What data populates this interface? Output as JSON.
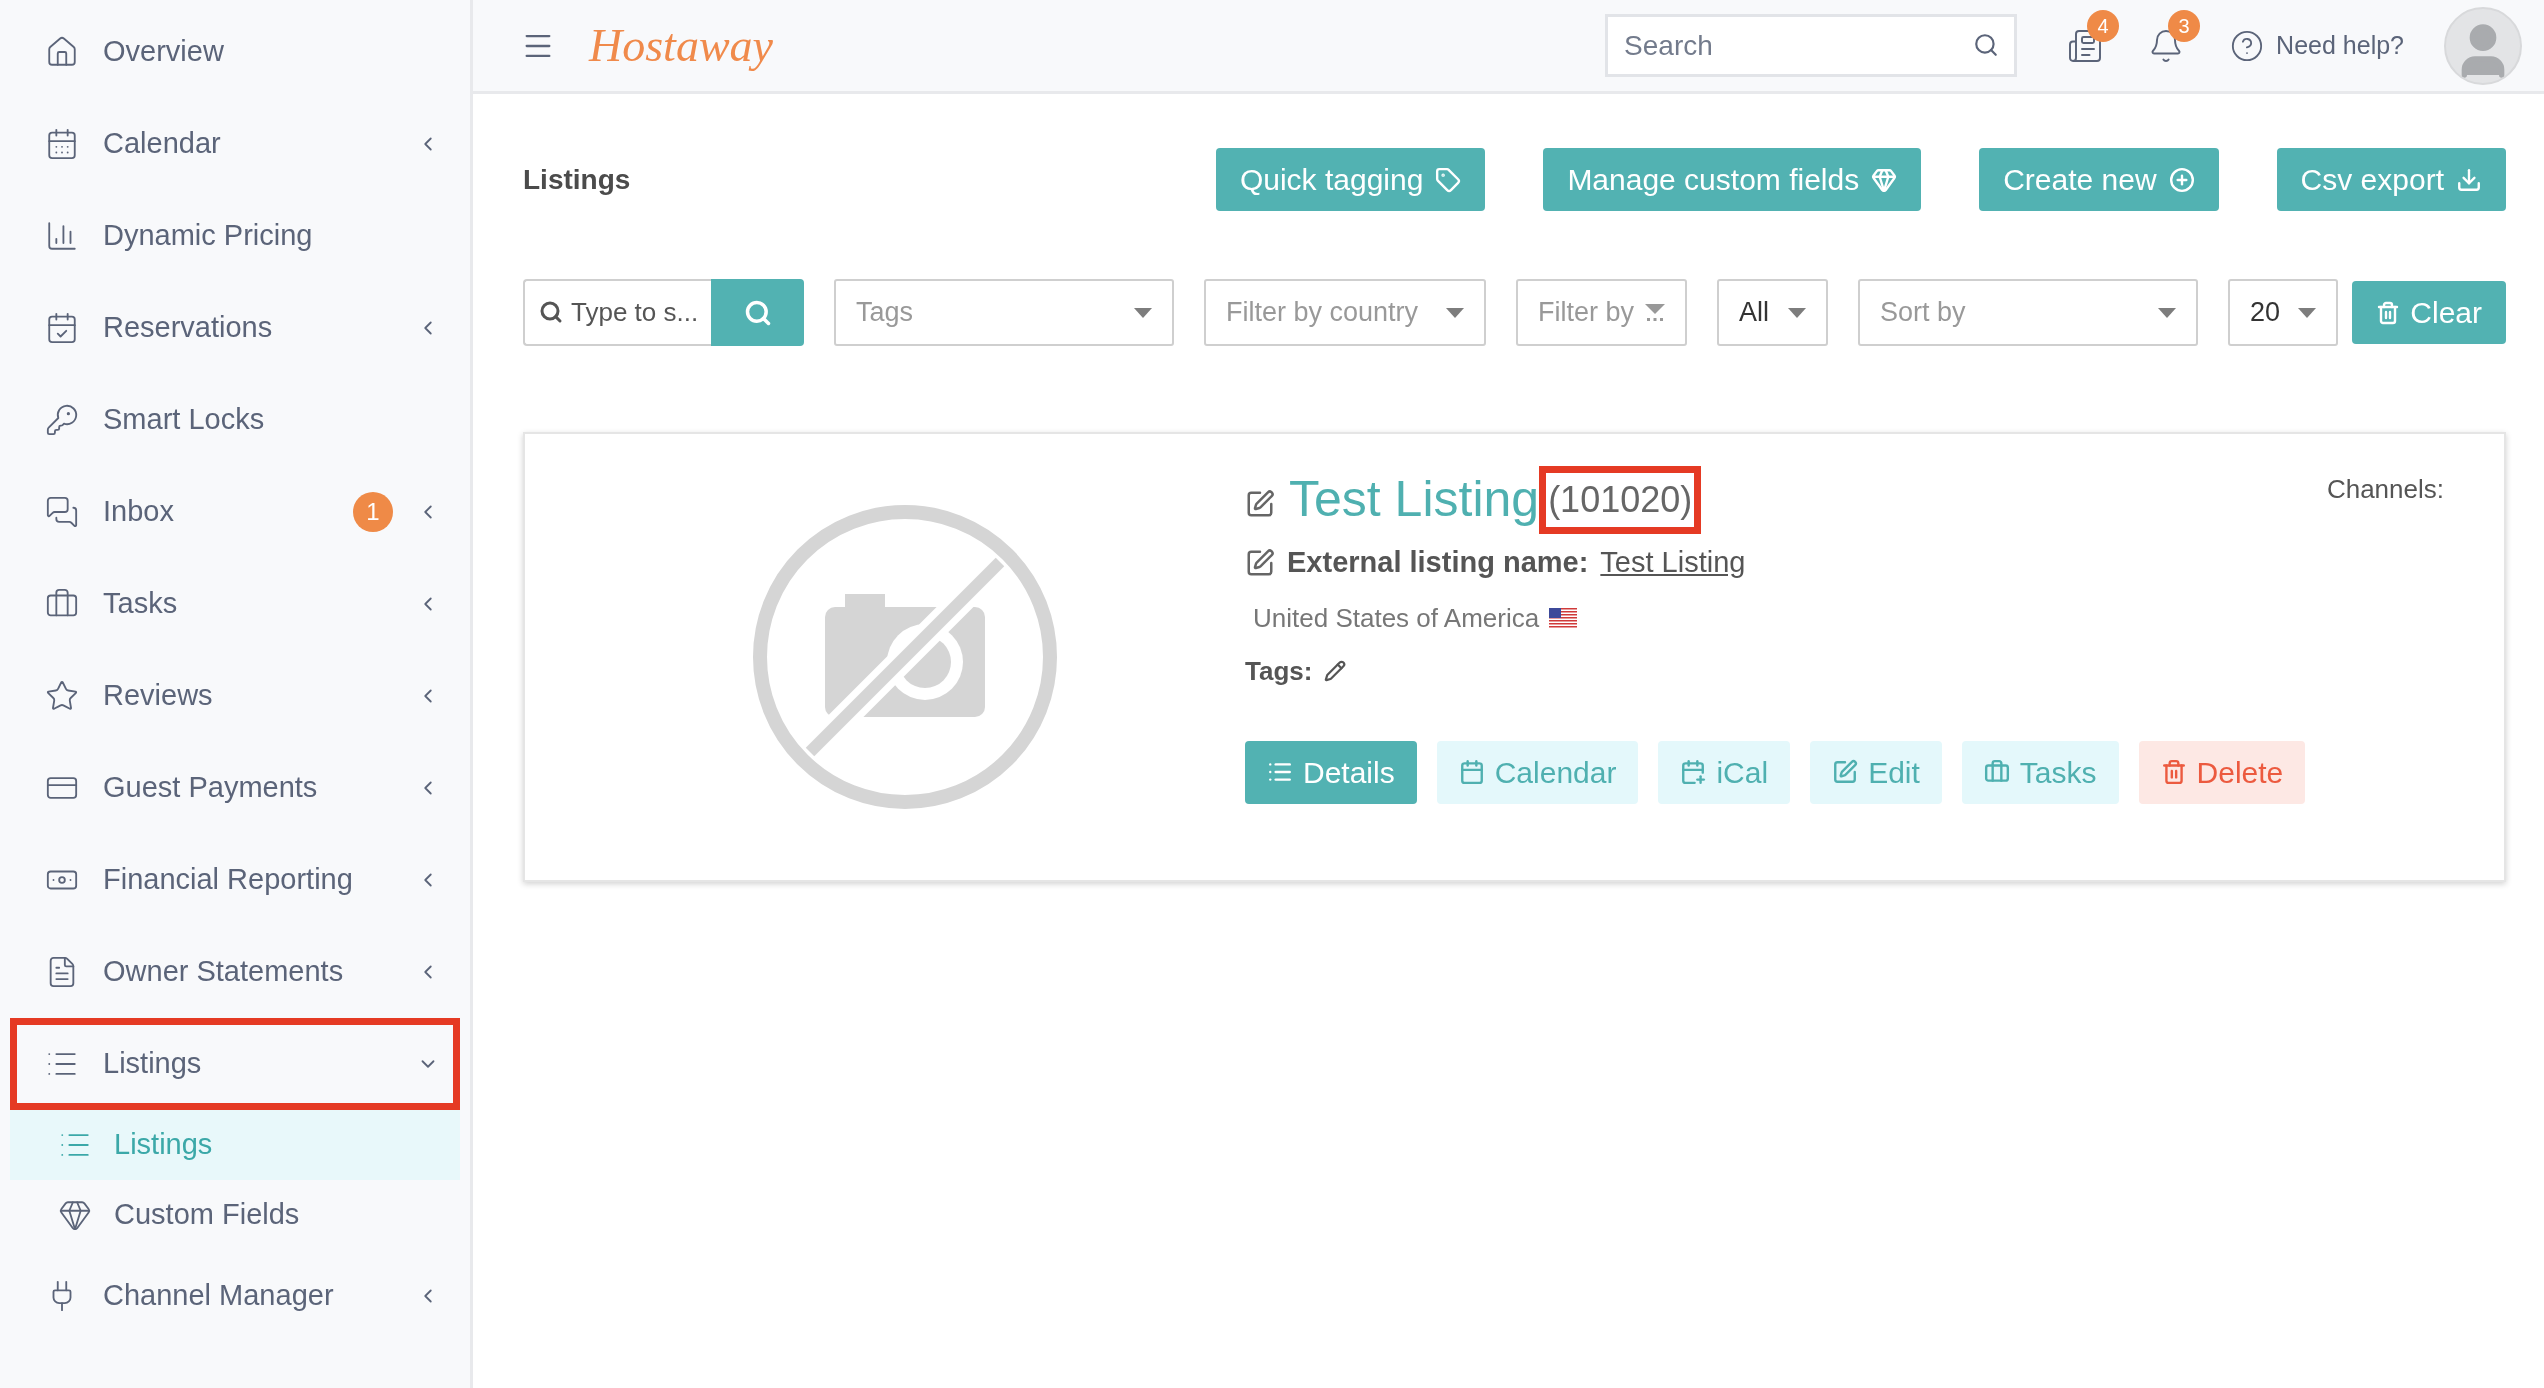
{
  "sidebar": {
    "items": [
      {
        "label": "Overview",
        "expandable": false,
        "highlighted": false
      },
      {
        "label": "Calendar",
        "expandable": true,
        "expanded": false,
        "highlighted": false
      },
      {
        "label": "Dynamic Pricing",
        "expandable": false,
        "highlighted": false
      },
      {
        "label": "Reservations",
        "expandable": true,
        "expanded": false,
        "highlighted": false
      },
      {
        "label": "Smart Locks",
        "expandable": false,
        "highlighted": false
      },
      {
        "label": "Inbox",
        "badge": "1",
        "expandable": true,
        "expanded": false,
        "highlighted": false
      },
      {
        "label": "Tasks",
        "expandable": true,
        "expanded": false,
        "highlighted": false
      },
      {
        "label": "Reviews",
        "expandable": true,
        "expanded": false,
        "highlighted": false
      },
      {
        "label": "Guest Payments",
        "expandable": true,
        "expanded": false,
        "highlighted": false
      },
      {
        "label": "Financial Reporting",
        "expandable": true,
        "expanded": false,
        "highlighted": false
      },
      {
        "label": "Owner Statements",
        "expandable": true,
        "expanded": false,
        "highlighted": false
      },
      {
        "label": "Listings",
        "expandable": true,
        "expanded": true,
        "highlighted": true,
        "children": [
          {
            "label": "Listings",
            "selected": true
          },
          {
            "label": "Custom Fields",
            "selected": false
          }
        ]
      },
      {
        "label": "Channel Manager",
        "expandable": true,
        "expanded": false,
        "highlighted": false
      }
    ]
  },
  "header": {
    "logo": "Hostaway",
    "search": {
      "placeholder": "Search"
    },
    "notifications": [
      {
        "badge": "4"
      },
      {
        "badge": "3"
      }
    ],
    "help": "Need help?"
  },
  "page": {
    "title": "Listings",
    "actions": [
      {
        "label": "Quick tagging"
      },
      {
        "label": "Manage custom fields"
      },
      {
        "label": "Create new"
      },
      {
        "label": "Csv export"
      }
    ]
  },
  "filters": {
    "search": {
      "placeholder": "Type to s..."
    },
    "dropdowns": [
      {
        "placeholder": "Tags"
      },
      {
        "placeholder": "Filter by country"
      },
      {
        "placeholder": "Filter by"
      },
      {
        "value": "All"
      },
      {
        "placeholder": "Sort by"
      },
      {
        "value": "20"
      }
    ],
    "clear": "Clear"
  },
  "listing": {
    "title": "Test Listing",
    "id": "(101020)",
    "id_highlighted": true,
    "external_label": "External listing name:",
    "external_name": "Test Listing",
    "country": "United States of America",
    "tags_label": "Tags:",
    "channels_label": "Channels:",
    "actions": [
      {
        "label": "Details",
        "kind": "primary"
      },
      {
        "label": "Calendar",
        "kind": "light"
      },
      {
        "label": "iCal",
        "kind": "light"
      },
      {
        "label": "Edit",
        "kind": "light"
      },
      {
        "label": "Tasks",
        "kind": "light"
      },
      {
        "label": "Delete",
        "kind": "danger"
      }
    ]
  }
}
